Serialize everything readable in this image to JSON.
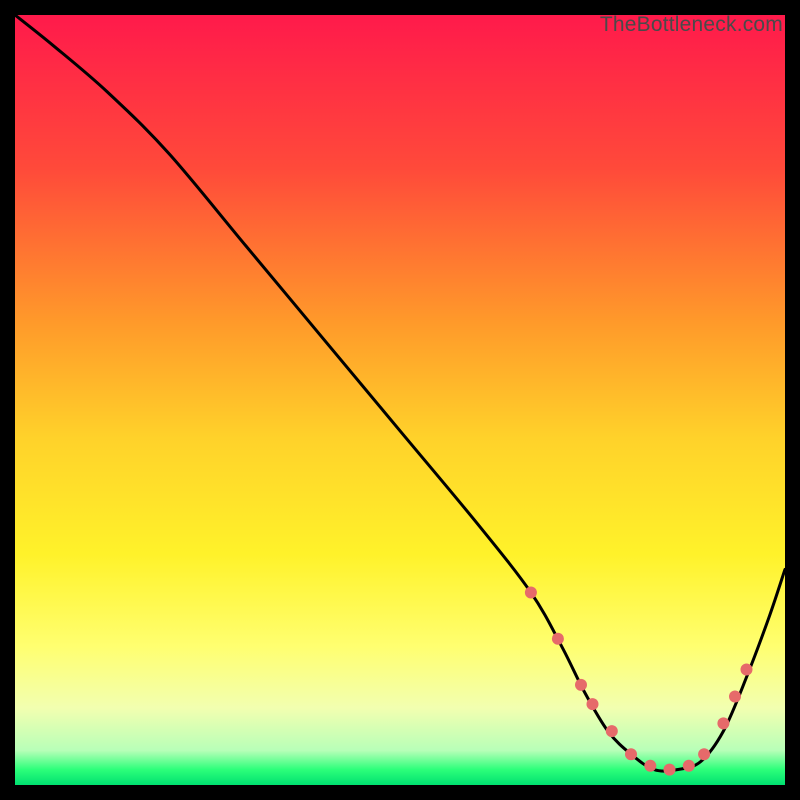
{
  "watermark": "TheBottleneck.com",
  "chart_data": {
    "type": "line",
    "title": "",
    "xlabel": "",
    "ylabel": "",
    "xlim": [
      0,
      100
    ],
    "ylim": [
      0,
      100
    ],
    "grid": false,
    "legend": false,
    "background_gradient": {
      "stops": [
        {
          "pos": 0.0,
          "color": "#ff1a4b"
        },
        {
          "pos": 0.2,
          "color": "#ff4a3a"
        },
        {
          "pos": 0.4,
          "color": "#ff9a2a"
        },
        {
          "pos": 0.55,
          "color": "#ffd22a"
        },
        {
          "pos": 0.7,
          "color": "#fff22a"
        },
        {
          "pos": 0.82,
          "color": "#ffff70"
        },
        {
          "pos": 0.9,
          "color": "#f2ffb0"
        },
        {
          "pos": 0.955,
          "color": "#b8ffb8"
        },
        {
          "pos": 0.98,
          "color": "#2cff7a"
        },
        {
          "pos": 1.0,
          "color": "#00e070"
        }
      ]
    },
    "series": [
      {
        "name": "bottleneck-curve",
        "color": "#000000",
        "x": [
          0,
          5,
          12,
          20,
          30,
          40,
          50,
          60,
          67,
          71,
          74,
          77,
          80,
          83,
          86,
          89,
          92,
          95,
          98,
          100
        ],
        "y": [
          100,
          96,
          90,
          82,
          70,
          58,
          46,
          34,
          25,
          18,
          12,
          7,
          4,
          2,
          2,
          3,
          7,
          14,
          22,
          28
        ]
      }
    ],
    "markers": {
      "name": "highlight-points",
      "color": "#e66a6a",
      "radius": 6,
      "x": [
        67.0,
        70.5,
        73.5,
        75.0,
        77.5,
        80.0,
        82.5,
        85.0,
        87.5,
        89.5,
        92.0,
        93.5,
        95.0
      ],
      "y": [
        25.0,
        19.0,
        13.0,
        10.5,
        7.0,
        4.0,
        2.5,
        2.0,
        2.5,
        4.0,
        8.0,
        11.5,
        15.0
      ]
    }
  }
}
